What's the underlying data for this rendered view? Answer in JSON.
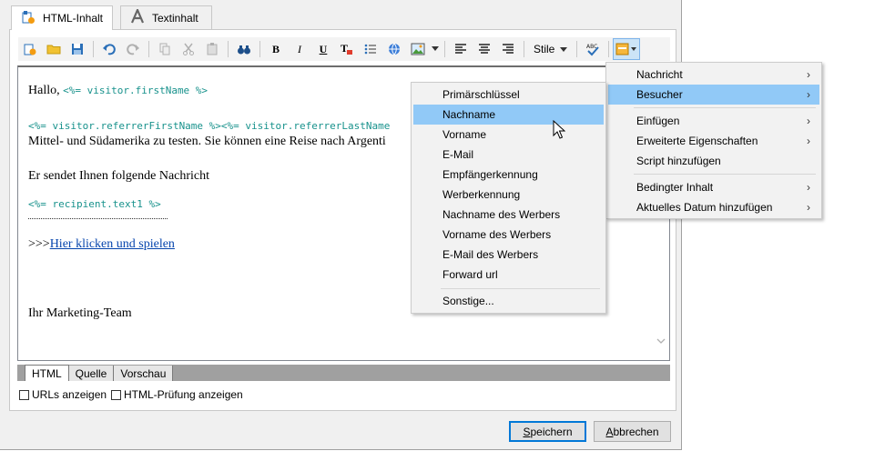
{
  "tabs": [
    {
      "label": "HTML-Inhalt",
      "icon": "html-content-icon"
    },
    {
      "label": "Textinhalt",
      "icon": "text-A-icon"
    }
  ],
  "toolbar": {
    "bold": "B",
    "italic": "I",
    "underline": "U",
    "style_label": "Stile"
  },
  "editor": {
    "greeting": "Hallo,",
    "code_firstname": "<%= visitor.firstName %>",
    "code_referrer": "<%= visitor.referrerFirstName %><%= visitor.referrerLastName",
    "line_travel": "Mittel- und Südamerika zu testen. Sie können eine Reise nach Argenti",
    "line_message": "Er sendet Ihnen folgende Nachricht",
    "code_recipient": "<%= recipient.text1 %>",
    "link_prefix": ">>>",
    "link_text": "Hier klicken und spielen",
    "signature": "Ihr Marketing-Team"
  },
  "view_tabs": [
    "HTML",
    "Quelle",
    "Vorschau"
  ],
  "checkboxes": [
    {
      "label": "URLs anzeigen",
      "checked": false
    },
    {
      "label": "HTML-Prüfung anzeigen",
      "checked": false
    }
  ],
  "buttons": {
    "save_mnemonic": "S",
    "save_rest": "peichern",
    "cancel_mnemonic": "A",
    "cancel_rest": "bbrechen"
  },
  "main_menu": {
    "items": [
      {
        "label": "Nachricht",
        "submenu": true
      },
      {
        "label": "Besucher",
        "submenu": true,
        "highlighted": true
      },
      {
        "label": "Einfügen",
        "submenu": true
      },
      {
        "label": "Erweiterte Eigenschaften",
        "submenu": true
      },
      {
        "label": "Script hinzufügen",
        "submenu": false
      },
      {
        "label": "Bedingter Inhalt",
        "submenu": true
      },
      {
        "label": "Aktuelles Datum hinzufügen",
        "submenu": true
      }
    ]
  },
  "sub_menu": {
    "items": [
      {
        "label": "Primärschlüssel"
      },
      {
        "label": "Nachname",
        "highlighted": true
      },
      {
        "label": "Vorname"
      },
      {
        "label": "E-Mail"
      },
      {
        "label": "Empfängerkennung"
      },
      {
        "label": "Werberkennung"
      },
      {
        "label": "Nachname des Werbers"
      },
      {
        "label": "Vorname des Werbers"
      },
      {
        "label": "E-Mail des Werbers"
      },
      {
        "label": "Forward url"
      },
      {
        "label": "Sonstige..."
      }
    ]
  },
  "colors": {
    "highlight": "#91c9f7",
    "code": "#18928c",
    "link": "#0645ad",
    "view_bar": "#a0a0a0"
  }
}
